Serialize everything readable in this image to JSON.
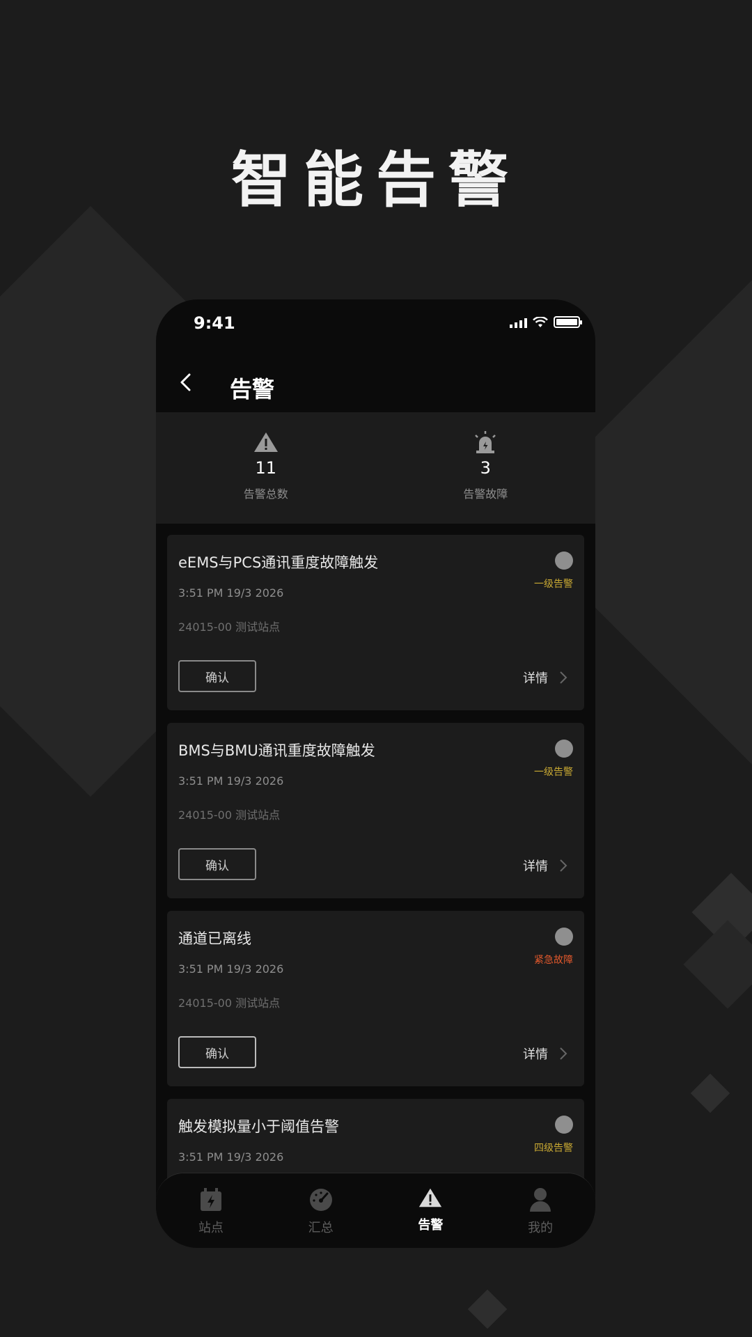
{
  "hero": {
    "title": "智能告警"
  },
  "status_bar": {
    "time": "9:41"
  },
  "header": {
    "title": "告警"
  },
  "summary": [
    {
      "icon": "warning-triangle-icon",
      "value": "11",
      "label": "告警总数"
    },
    {
      "icon": "alarm-siren-icon",
      "value": "3",
      "label": "告警故障"
    }
  ],
  "alarms": [
    {
      "title": "eEMS与PCS通讯重度故障触发",
      "time": "3:51 PM 19/3 2026",
      "site": "24015-00 测试站点",
      "level": "一级告警",
      "level_color": "#c9a933",
      "confirm_label": "确认",
      "detail_label": "详情"
    },
    {
      "title": "BMS与BMU通讯重度故障触发",
      "time": "3:51 PM 19/3 2026",
      "site": "24015-00 测试站点",
      "level": "一级告警",
      "level_color": "#c9a933",
      "confirm_label": "确认",
      "detail_label": "详情"
    },
    {
      "title": "通道已离线",
      "time": "3:51 PM 19/3 2026",
      "site": "24015-00 测试站点",
      "level": "紧急故障",
      "level_color": "#e0582c",
      "confirm_label": "确认",
      "detail_label": "详情"
    },
    {
      "title": "触发模拟量小于阈值告警",
      "time": "3:51 PM 19/3 2026",
      "site": "",
      "level": "四级告警",
      "level_color": "#c9a933",
      "confirm_label": "",
      "detail_label": ""
    }
  ],
  "tabs": [
    {
      "icon": "station-icon",
      "label": "站点",
      "active": false
    },
    {
      "icon": "gauge-icon",
      "label": "汇总",
      "active": false
    },
    {
      "icon": "warning-triangle-icon",
      "label": "告警",
      "active": true
    },
    {
      "icon": "user-icon",
      "label": "我的",
      "active": false
    }
  ]
}
